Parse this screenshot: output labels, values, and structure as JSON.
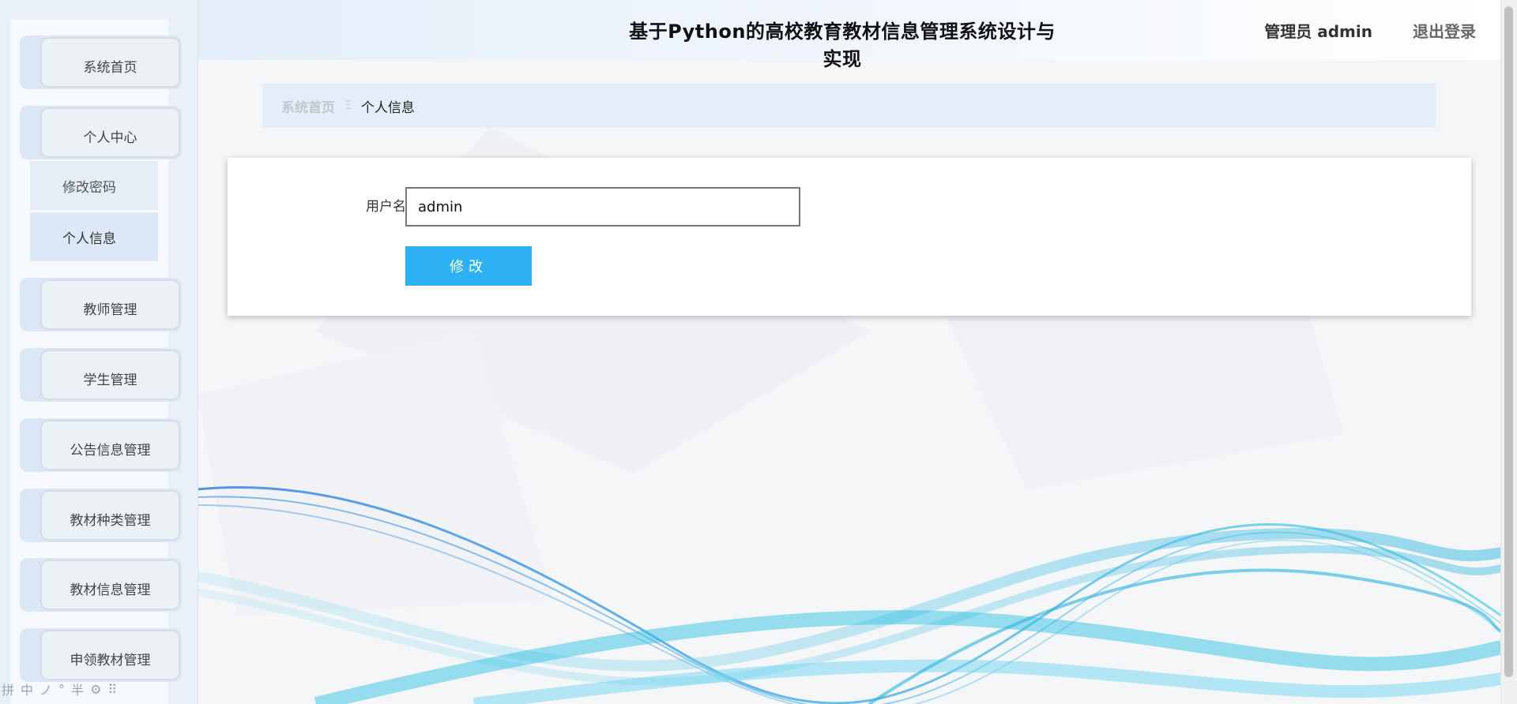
{
  "app": {
    "title": "基于Python的高校教育教材信息管理系统设计与实现",
    "user_label": "管理员 admin",
    "logout_label": "退出登录"
  },
  "sidebar": {
    "items": [
      {
        "label": "系统首页"
      },
      {
        "label": "个人中心"
      },
      {
        "label": "教师管理"
      },
      {
        "label": "学生管理"
      },
      {
        "label": "公告信息管理"
      },
      {
        "label": "教材种类管理"
      },
      {
        "label": "教材信息管理"
      },
      {
        "label": "申领教材管理"
      }
    ],
    "submenu": [
      {
        "label": "修改密码"
      },
      {
        "label": "个人信息"
      }
    ]
  },
  "breadcrumb": {
    "home": "系统首页",
    "separator": "Ξ",
    "current": "个人信息"
  },
  "form": {
    "username_label": "用户名",
    "username_value": "admin",
    "submit_label": "修改"
  },
  "ime_toolbar": [
    "拼",
    "中",
    "ノ",
    "°",
    "半",
    "⚙",
    "⠿"
  ],
  "colors": {
    "accent": "#2db1f4",
    "header_bg": "#e4eefa",
    "breadcrumb_bg": "#e4eefb",
    "sidebar_bg": "#eaf0f8"
  }
}
